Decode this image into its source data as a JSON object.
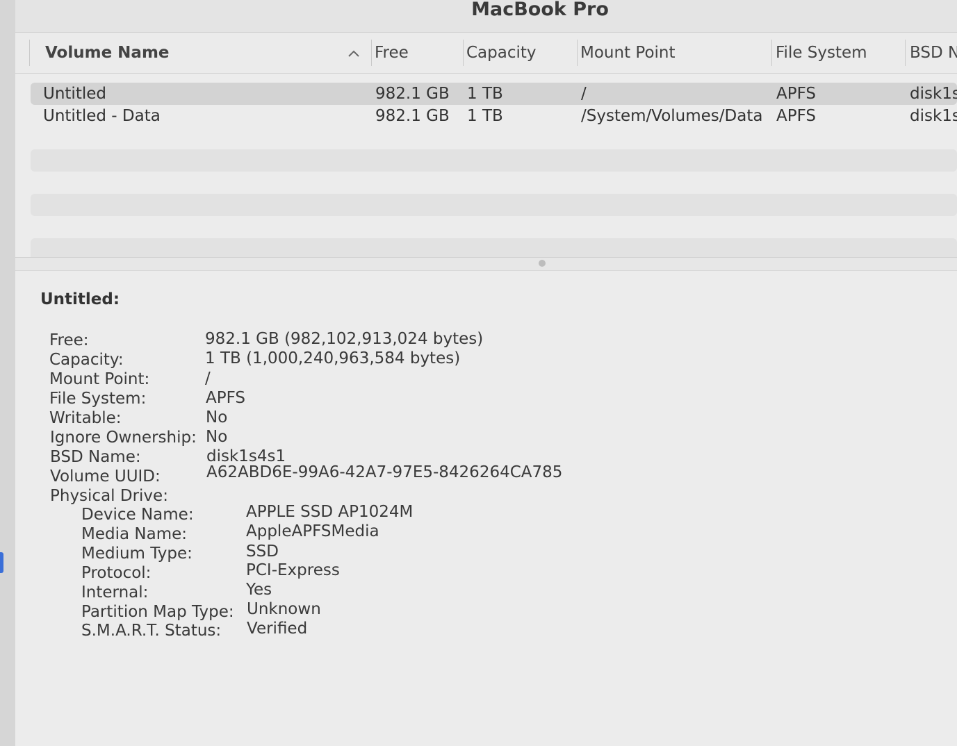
{
  "window": {
    "title": "MacBook Pro"
  },
  "table": {
    "columns": [
      "Volume Name",
      "Free",
      "Capacity",
      "Mount Point",
      "File System",
      "BSD N"
    ],
    "rows": [
      {
        "volume_name": "Untitled",
        "free": "982.1 GB",
        "capacity": "1 TB",
        "mount_point": "/",
        "file_system": "APFS",
        "bsd": "disk1s"
      },
      {
        "volume_name": "Untitled - Data",
        "free": "982.1 GB",
        "capacity": "1 TB",
        "mount_point": "/System/Volumes/Data",
        "file_system": "APFS",
        "bsd": "disk1s"
      }
    ],
    "selected_row": 0
  },
  "detail": {
    "title": "Untitled:",
    "fields": [
      {
        "label": "Free:",
        "value": "982.1 GB (982,102,913,024 bytes)"
      },
      {
        "label": "Capacity:",
        "value": "1 TB (1,000,240,963,584 bytes)"
      },
      {
        "label": "Mount Point:",
        "value": "/"
      },
      {
        "label": "File System:",
        "value": "APFS"
      },
      {
        "label": "Writable:",
        "value": "No"
      },
      {
        "label": "Ignore Ownership:",
        "value": "No"
      },
      {
        "label": "BSD Name:",
        "value": "disk1s4s1"
      },
      {
        "label": "Volume UUID:",
        "value": "A62ABD6E-99A6-42A7-97E5-8426264CA785"
      },
      {
        "label": "Physical Drive:",
        "value": ""
      }
    ],
    "physical_drive": [
      {
        "label": "Device Name:",
        "value": "APPLE SSD AP1024M"
      },
      {
        "label": "Media Name:",
        "value": "AppleAPFSMedia"
      },
      {
        "label": "Medium Type:",
        "value": "SSD"
      },
      {
        "label": "Protocol:",
        "value": "PCI-Express"
      },
      {
        "label": "Internal:",
        "value": "Yes"
      },
      {
        "label": "Partition Map Type:",
        "value": "Unknown"
      },
      {
        "label": "S.M.A.R.T. Status:",
        "value": "Verified"
      }
    ]
  },
  "colors": {
    "background": "#ececec",
    "selection": "#d3d3d3",
    "accent": "#3b6fd8"
  }
}
